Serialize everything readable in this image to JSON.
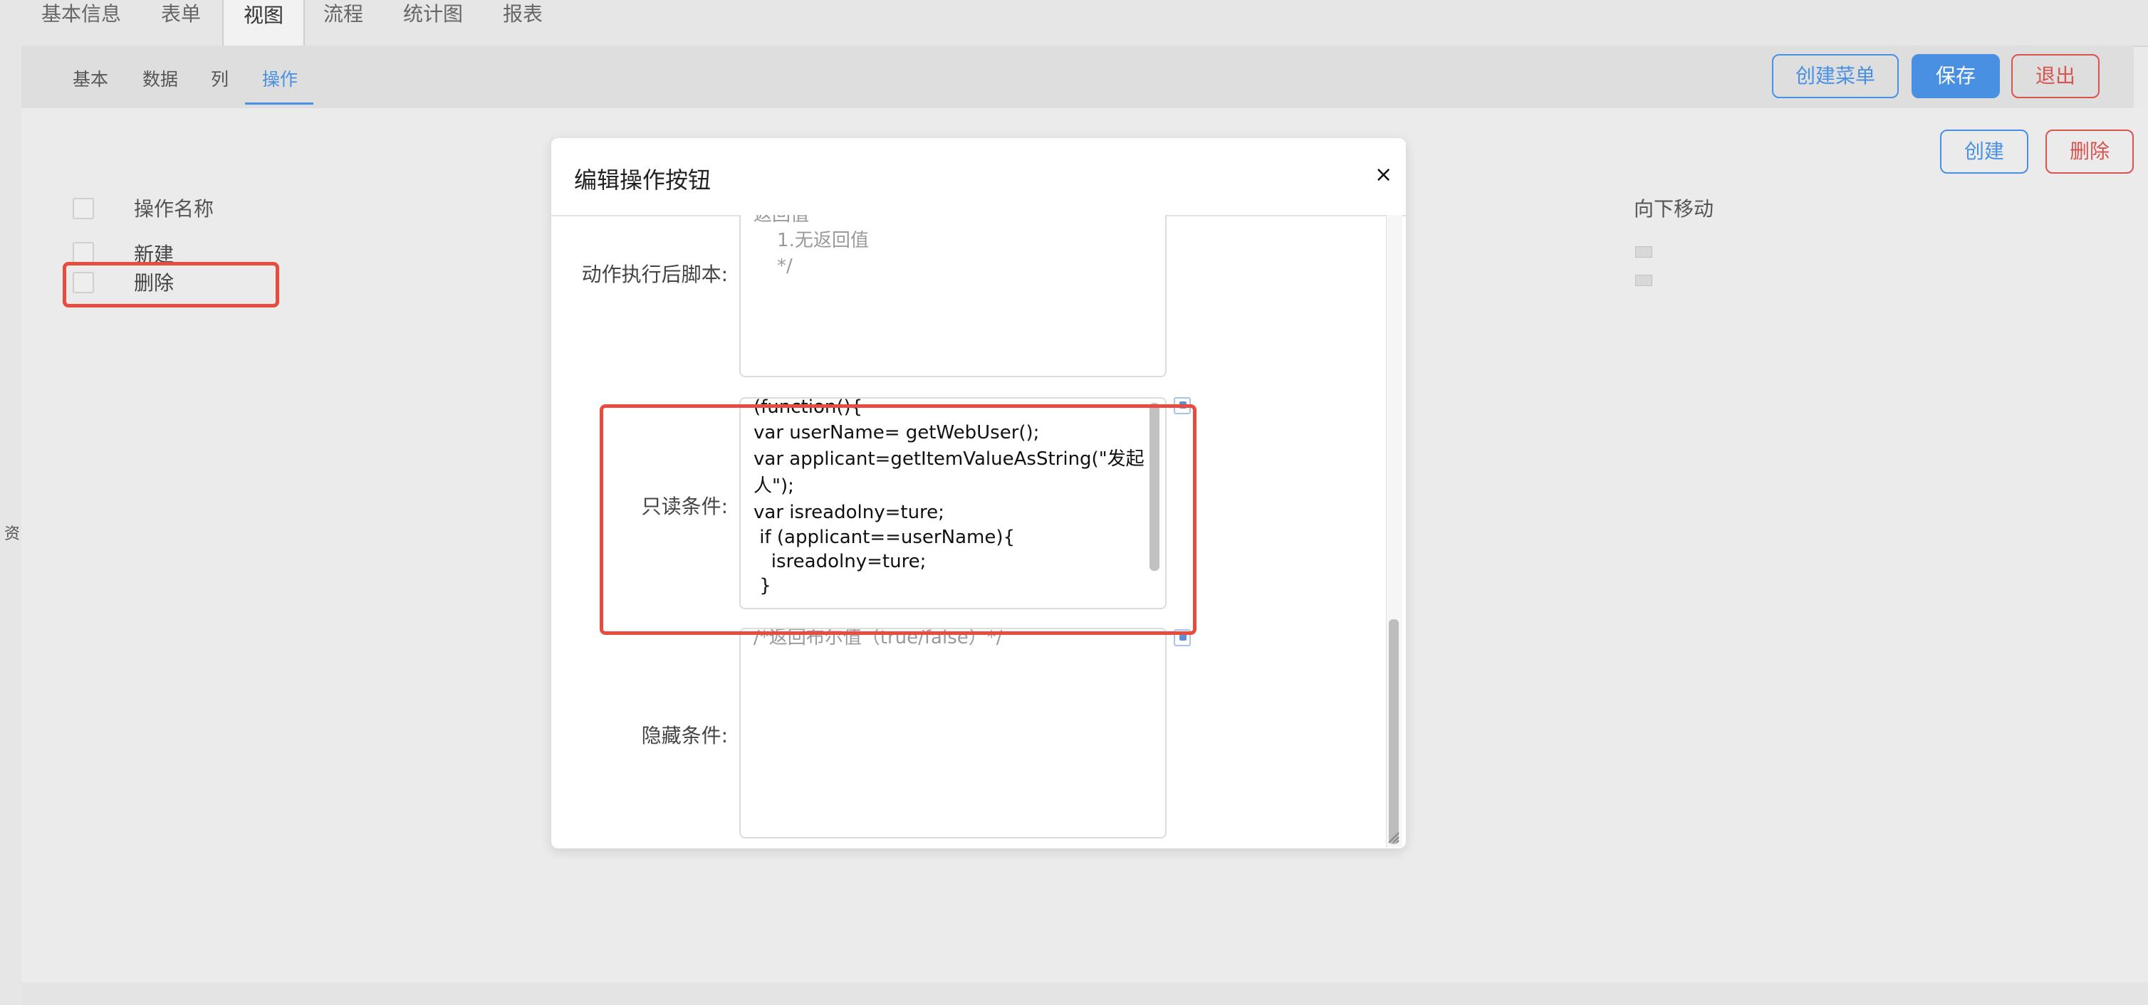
{
  "side_label": "资",
  "top_tabs": [
    "基本信息",
    "表单",
    "视图",
    "流程",
    "统计图",
    "报表"
  ],
  "sub_tabs": [
    "基本",
    "数据",
    "列",
    "操作"
  ],
  "header_buttons": {
    "create_menu": "创建菜单",
    "save": "保存",
    "exit": "退出"
  },
  "toolbar": {
    "create": "创建",
    "delete": "删除"
  },
  "table": {
    "col_name": "操作名称",
    "col_move_down": "向下移动",
    "rows": [
      "新建",
      "删除"
    ]
  },
  "modal": {
    "title": "编辑操作按钮",
    "close_icon": "×",
    "after_script_label": "动作执行后脚本:",
    "after_script_lines": [
      "返回值",
      "    1.无返回值",
      "    */"
    ],
    "readonly_label": "只读条件:",
    "readonly_lines": [
      "(function(){",
      "var userName= getWebUser();",
      "var applicant=getItemValueAsString(\"发起",
      "人\");",
      "var isreadolny=ture;",
      " if (applicant==userName){",
      "   isreadolny=ture;",
      " }"
    ],
    "hidden_label": "隐藏条件:",
    "hidden_line": "/*返回布尔值（true/false）*/"
  },
  "colors": {
    "accent": "#4a90e2",
    "danger": "#d9534f",
    "highlight": "#e74c3c"
  }
}
